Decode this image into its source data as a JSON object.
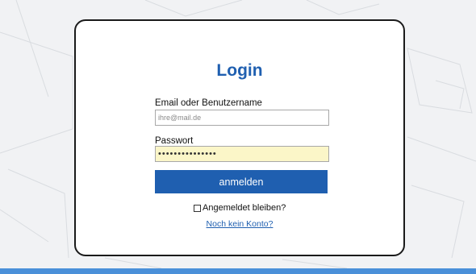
{
  "login": {
    "title": "Login",
    "username_label": "Email oder Benutzername",
    "username_placeholder": "ihre@mail.de",
    "username_value": "",
    "password_label": "Passwort",
    "password_value": "•••••••••••••••",
    "submit_label": "anmelden",
    "remember_label": "Angemeldet bleiben?",
    "remember_checked": false,
    "signup_link": "Noch kein Konto?"
  },
  "colors": {
    "accent": "#1f5fb0",
    "password_fill": "#fbf6c8",
    "footer_bar": "#4a90d9"
  }
}
